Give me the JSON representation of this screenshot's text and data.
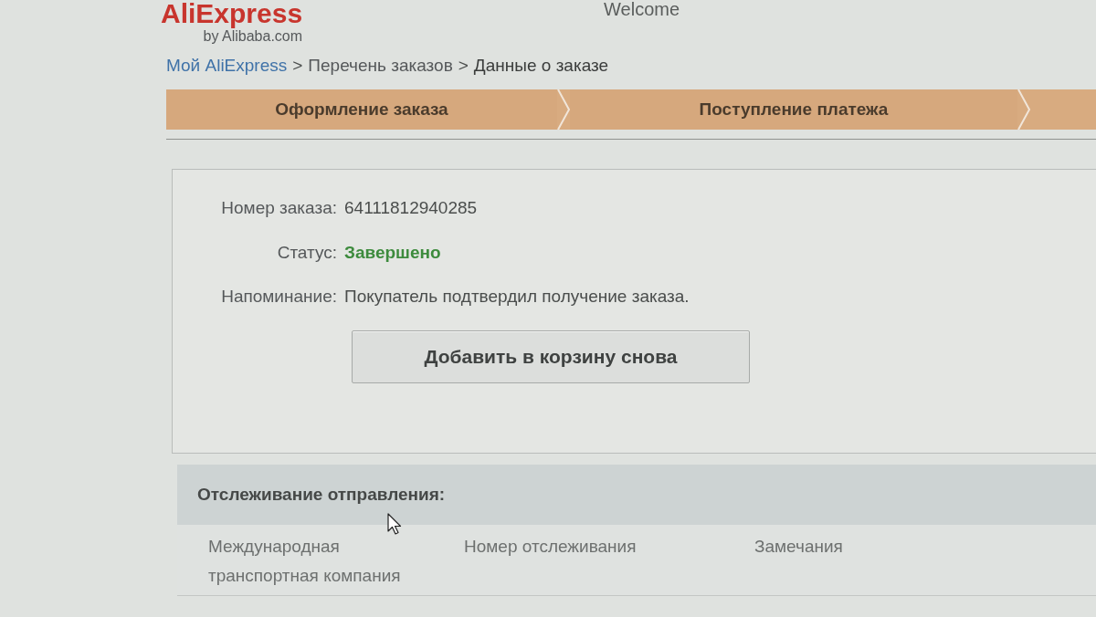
{
  "header": {
    "logo": "AliExpress",
    "logo_tagline": "by Alibaba.com",
    "welcome": "Welcome"
  },
  "breadcrumb": [
    {
      "kind": "link",
      "label": "Мой AliExpress"
    },
    {
      "kind": "separator",
      "label": ">"
    },
    {
      "kind": "text",
      "label": "Перечень заказов"
    },
    {
      "kind": "separator",
      "label": ">"
    },
    {
      "kind": "text",
      "label": "Данные о заказе"
    }
  ],
  "steps": [
    {
      "label": "Оформление заказа",
      "done": true
    },
    {
      "label": "Поступление платежа",
      "done": true
    }
  ],
  "order": {
    "fields": [
      {
        "kind": "plain",
        "label": "Номер заказа:",
        "value": "64111812940285"
      },
      {
        "kind": "status",
        "label": "Статус:",
        "value": "Завершено"
      },
      {
        "kind": "plain",
        "label": "Напоминание:",
        "value": "Покупатель подтвердил получение заказа."
      }
    ],
    "button": "Добавить в корзину снова"
  },
  "tracking": {
    "title": "Отслеживание отправления:",
    "columns": [
      "Международная транспортная компания",
      "Номер отслеживания",
      "Замечания"
    ]
  }
}
